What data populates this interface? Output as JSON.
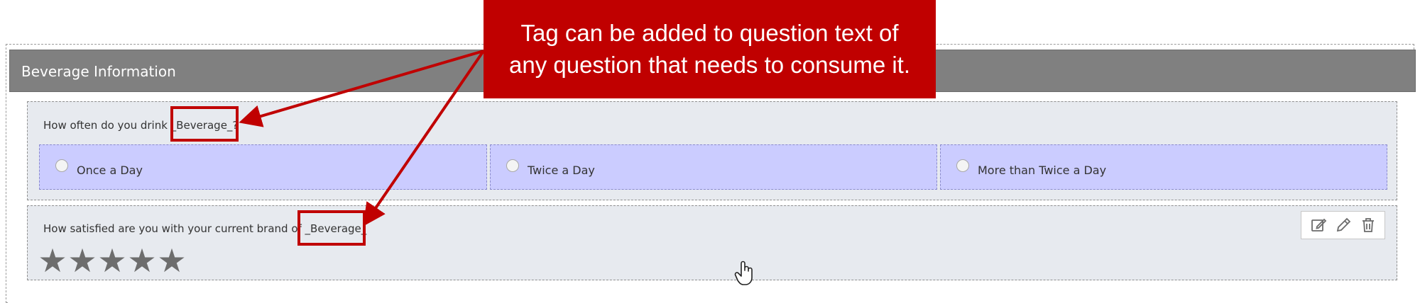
{
  "section": {
    "title": "Beverage Information"
  },
  "questions": [
    {
      "text": "How often do you drink _Beverage_?",
      "options": [
        "Once a Day",
        "Twice a Day",
        "More than Twice a Day"
      ]
    },
    {
      "text": "How satisfied are you with your current brand of _Beverage_",
      "rating": {
        "max": 5,
        "value": 5,
        "icon": "star-icon"
      }
    }
  ],
  "toolbar": {
    "icons": [
      "edit-square-icon",
      "pencil-icon",
      "trash-icon"
    ]
  },
  "annotation": {
    "callout_lines": [
      "Tag can be added to question text of",
      "any question that needs to consume it."
    ],
    "color": "#c00000"
  },
  "colors": {
    "header": "#808080",
    "question_bg": "#e7eaef",
    "option_bg": "#cbccff",
    "star": "#6d6d6d"
  }
}
